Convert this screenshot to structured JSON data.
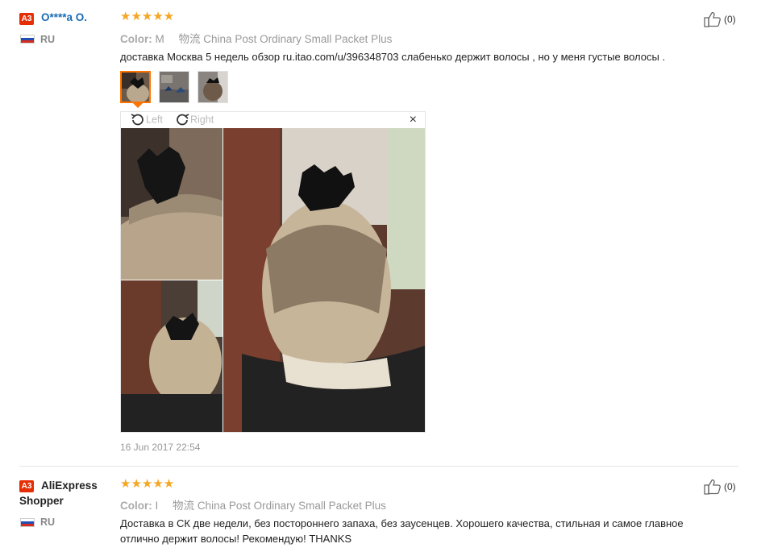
{
  "reviews": [
    {
      "badge": "A3",
      "user": "O****a O.",
      "country": "RU",
      "stars": "★★★★★",
      "color_label": "Color:",
      "color_value": "M",
      "shipping_cn": "物流",
      "shipping": "China Post Ordinary Small Packet Plus",
      "text": "доставка Москва 5 недель обзор ru.itao.com/u/396348703 слабенько держит волосы , но у меня густые волосы .",
      "likes": "(0)",
      "viewer": {
        "rotate_left": "Left",
        "rotate_right": "Right",
        "close": "×"
      },
      "date": "16 Jun 2017 22:54"
    },
    {
      "badge": "A3",
      "user_line1": "AliExpress",
      "user_line2": "Shopper",
      "country": "RU",
      "stars": "★★★★★",
      "color_label": "Color:",
      "color_value": "I",
      "shipping_cn": "物流",
      "shipping": "China Post Ordinary Small Packet Plus",
      "text_line1": "Доставка в СК две недели, без постороннего запаха, без заусенцев. Хорошего качества, стильная и самое главное",
      "text_line2": "отлично держит волосы! Рекомендую! THANKS",
      "likes": "(0)"
    }
  ],
  "colors": {
    "brand_red": "#e62e04",
    "link_blue": "#1a6bb5",
    "star": "#f5a623",
    "active_border": "#ff7300"
  }
}
